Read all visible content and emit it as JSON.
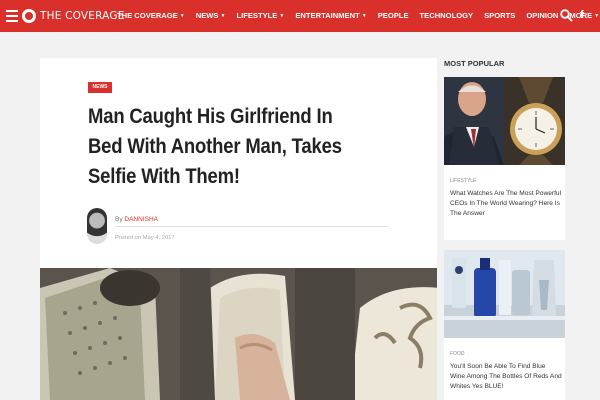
{
  "nav": {
    "logo": "THE COVERAGE",
    "menu": [
      {
        "label": "THE COVERAGE",
        "caret": true
      },
      {
        "label": "NEWS",
        "caret": true
      },
      {
        "label": "LIFESTYLE",
        "caret": true
      },
      {
        "label": "ENTERTAINMENT",
        "caret": true
      },
      {
        "label": "PEOPLE",
        "caret": false
      },
      {
        "label": "TECHNOLOGY",
        "caret": false
      },
      {
        "label": "SPORTS",
        "caret": false
      },
      {
        "label": "OPINION",
        "caret": false
      },
      {
        "label": "MORE",
        "caret": true
      }
    ],
    "facebook": "f",
    "accent_color": "#d9302c"
  },
  "article": {
    "category": "NEWS",
    "title": "Man Caught His Girlfriend In Bed With Another Man, Takes Selfie With Them!",
    "byline_prefix": "By",
    "author": "DANNISHA",
    "posted": "Posted on May 4, 2017"
  },
  "sidebar": {
    "heading": "MOST POPULAR",
    "cards": [
      {
        "category": "LIFESTYLE",
        "title": "What Watches Are The Most Powerful CEOs In The World Wearing? Here Is The Answer"
      },
      {
        "category": "FOOD",
        "title": "You'll Soon Be Able To Find Blue Wine Among The Bottles Of Reds And Whites Yes BLUE!"
      }
    ]
  }
}
